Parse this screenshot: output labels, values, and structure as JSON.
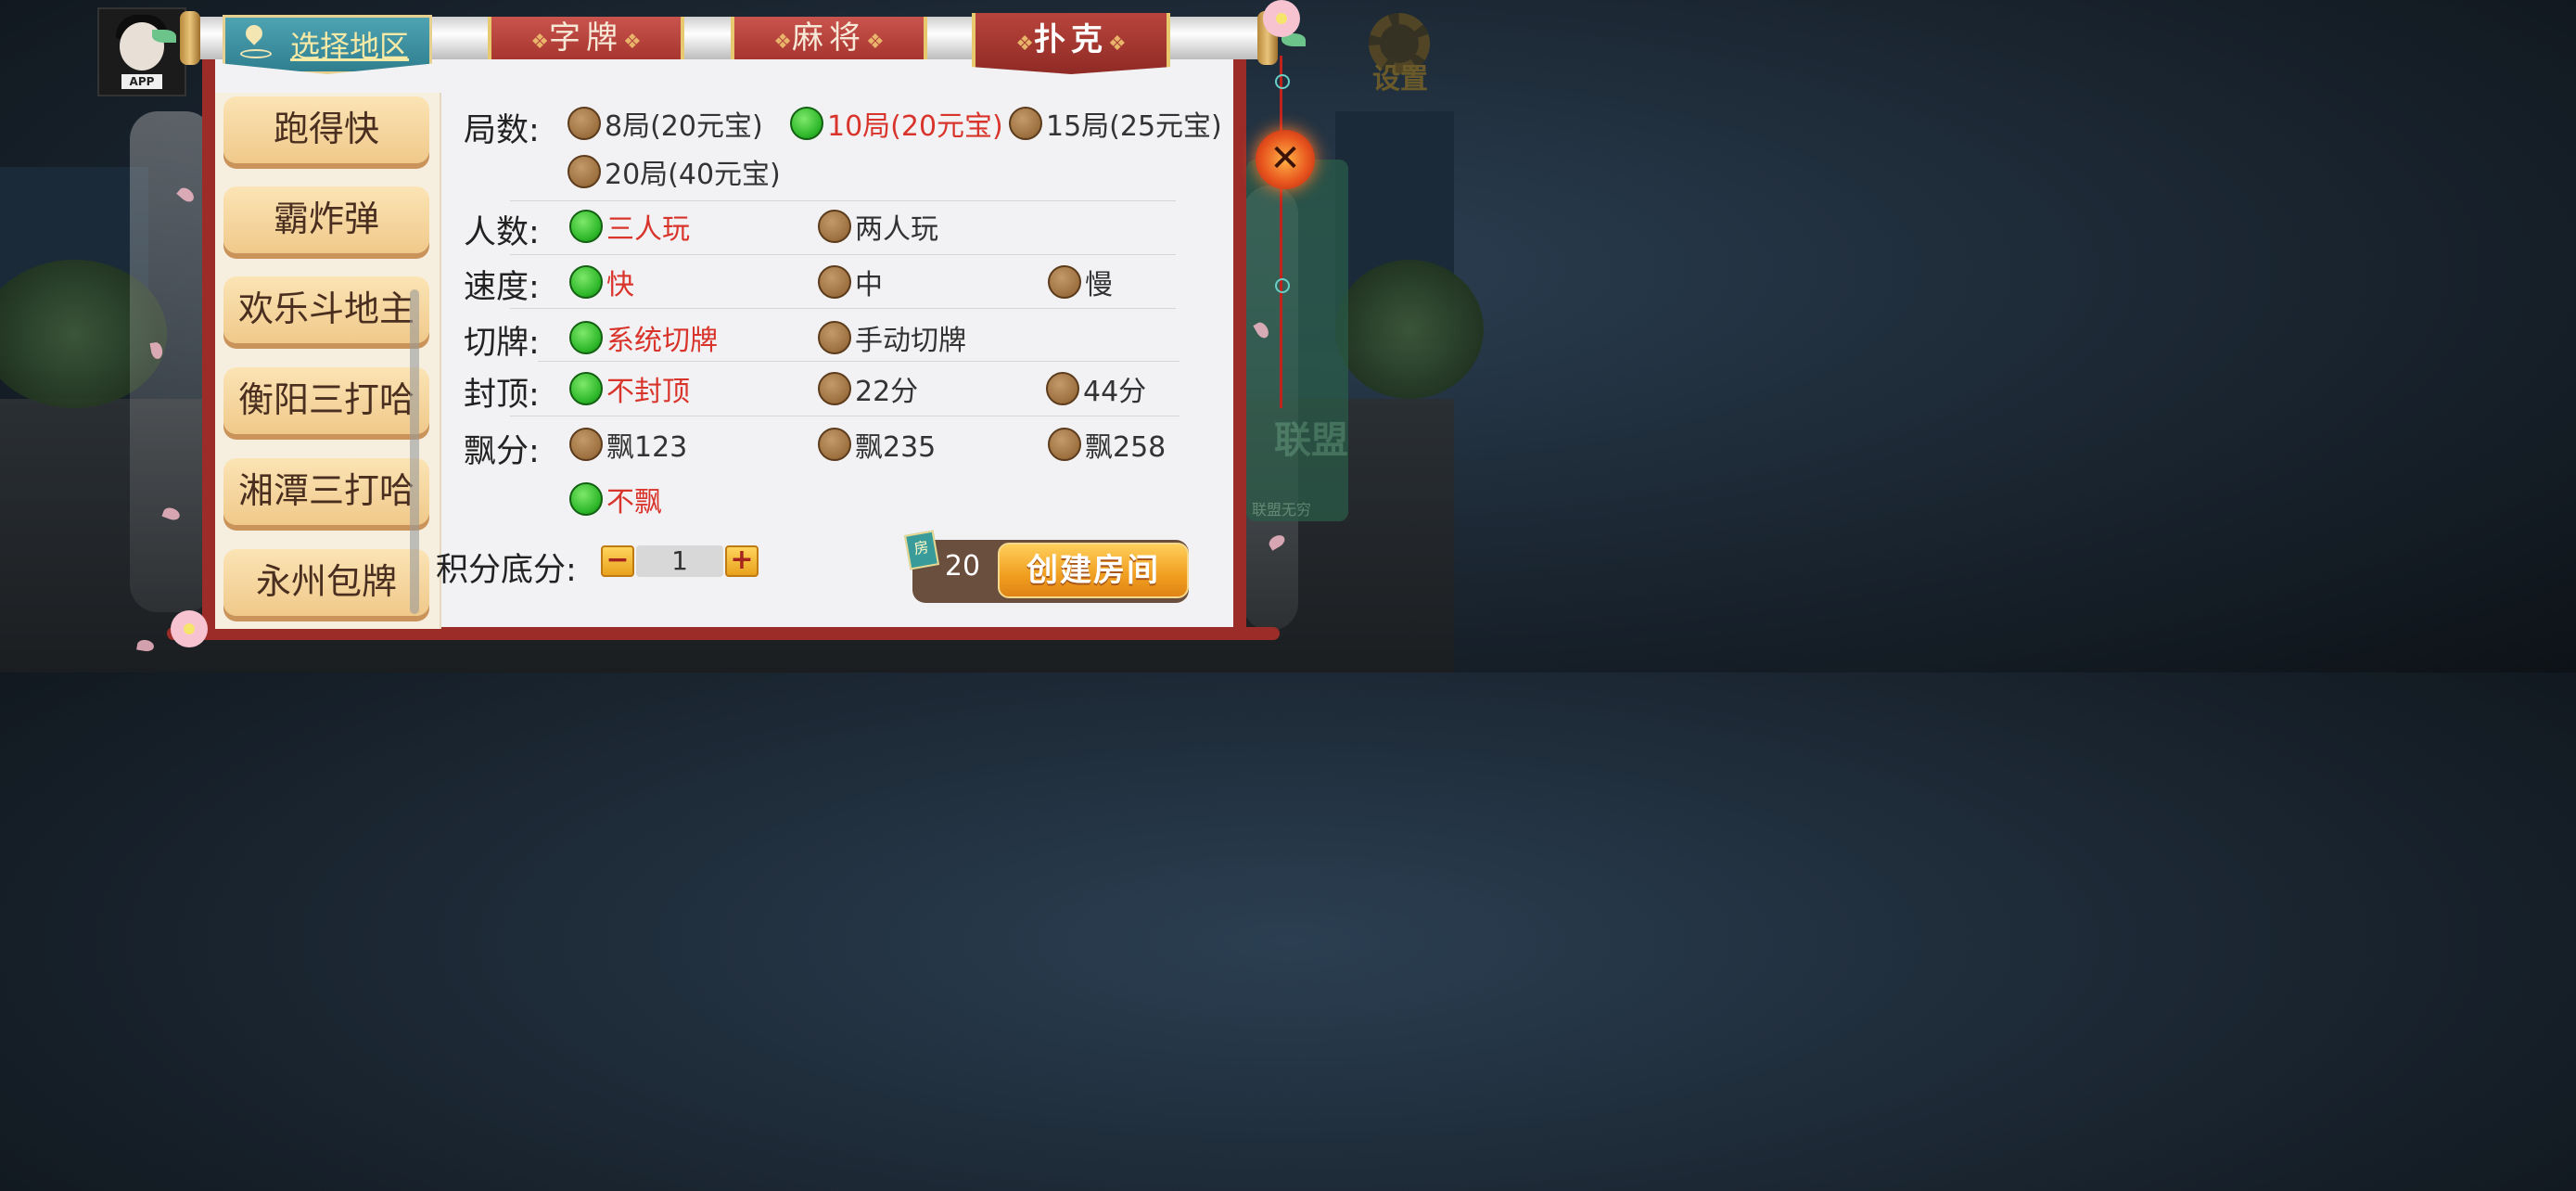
{
  "avatar": {
    "tag": "APP"
  },
  "settings": {
    "label": "设置"
  },
  "top_tabs": {
    "region": "选择地区",
    "tabs": [
      {
        "label": "字牌",
        "active": false
      },
      {
        "label": "麻将",
        "active": false
      },
      {
        "label": "扑克",
        "active": true
      }
    ],
    "ornament": "❖"
  },
  "sidebar": {
    "items": [
      "跑得快",
      "霸炸弹",
      "欢乐斗地主",
      "衡阳三打哈",
      "湘潭三打哈",
      "永州包牌"
    ]
  },
  "options": {
    "rounds": {
      "label": "局数:",
      "choices": [
        "8局(20元宝)",
        "10局(20元宝)",
        "15局(25元宝)",
        "20局(40元宝)"
      ],
      "selected": 1
    },
    "players": {
      "label": "人数:",
      "choices": [
        "三人玩",
        "两人玩"
      ],
      "selected": 0
    },
    "speed": {
      "label": "速度:",
      "choices": [
        "快",
        "中",
        "慢"
      ],
      "selected": 0
    },
    "cut": {
      "label": "切牌:",
      "choices": [
        "系统切牌",
        "手动切牌"
      ],
      "selected": 0
    },
    "cap": {
      "label": "封顶:",
      "choices": [
        "不封顶",
        "22分",
        "44分"
      ],
      "selected": 0
    },
    "float": {
      "label": "飘分:",
      "choices": [
        "飘123",
        "飘235",
        "飘258",
        "不飘"
      ],
      "selected": 3
    }
  },
  "score": {
    "label": "积分底分:",
    "minus": "−",
    "plus": "+",
    "value": "1"
  },
  "create": {
    "card_label": "房",
    "cost": "20",
    "button": "创建房间"
  },
  "close": {
    "symbol": "✕"
  },
  "right_panel": {
    "title": "联盟",
    "subtitle": "联盟无穷"
  },
  "colors": {
    "accent_red": "#9b2c28",
    "selected_text": "#d9342b",
    "selected_dot": "#2eb82a",
    "unselected_dot": "#9c6f3e",
    "button_orange": "#f09e1f"
  }
}
